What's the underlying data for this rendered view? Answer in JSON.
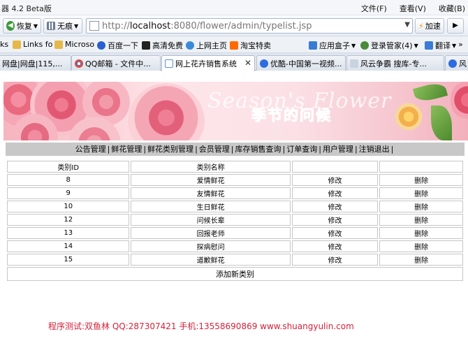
{
  "browser": {
    "app_title": "器 4.2 Beta版",
    "menus": [
      "文件(F)",
      "查看(V)",
      "收藏(B)"
    ],
    "toolbar": {
      "back_label": "恢复",
      "trace_label": "无痕",
      "url_scheme": "http://",
      "url_host": "localhost",
      "url_rest": ":8080/flower/admin/typelist.jsp",
      "speed_label": "加速"
    },
    "bookmarks": [
      {
        "label": "ks",
        "icon": "bookmark-icon",
        "color": "#5b7db8"
      },
      {
        "label": "Links fo",
        "icon": "folder-icon",
        "color": "#e6b84a"
      },
      {
        "label": "Microso",
        "icon": "folder-icon",
        "color": "#e6b84a"
      },
      {
        "label": "百度一下",
        "icon": "baidu-paw-icon",
        "color": "#2b5fcf"
      },
      {
        "label": "高清免费",
        "icon": "movie-icon",
        "color": "#222222"
      },
      {
        "label": "上网主页",
        "icon": "home-page-icon",
        "color": "#3b8ad8"
      },
      {
        "label": "淘宝特卖",
        "icon": "taobao-icon",
        "color": "#ff6a00"
      },
      {
        "label": "应用盒子",
        "icon": "app-box-icon",
        "color": "#3a7bd5"
      },
      {
        "label": "登录管家(4)",
        "icon": "login-manager-icon",
        "color": "#4a8a3a"
      },
      {
        "label": "翻译",
        "icon": "translate-icon",
        "color": "#3a7bd5"
      }
    ],
    "tabs": [
      {
        "label": "网盘|网盘|115,...",
        "icon": "tab-page-icon",
        "color": "#7a9fd1",
        "active": false
      },
      {
        "label": "QQ邮箱 - 文件中...",
        "icon": "chrome-tab-icon",
        "color": "#e0493a",
        "active": false
      },
      {
        "label": "网上花卉销售系统",
        "icon": "tab-page-icon",
        "color": "#5b8fd6",
        "active": true
      },
      {
        "label": "优酷-中国第一视频...",
        "icon": "youku-icon",
        "color": "#2d6cdf",
        "active": false
      },
      {
        "label": "风云争霸 搜库-专...",
        "icon": "tab-page-icon",
        "color": "#9aa9bd",
        "active": false
      },
      {
        "label": "风",
        "icon": "youku-icon",
        "color": "#2d6cdf",
        "active": false
      }
    ]
  },
  "page": {
    "banner": {
      "title": "季节的问候",
      "watermark": "Season's Flower"
    },
    "nav_items": [
      "公告管理",
      "鲜花管理",
      "鲜花类别管理",
      "会员管理",
      "库存销售查询",
      "订单查询",
      "用户管理",
      "注销退出"
    ],
    "table": {
      "headers": [
        "类别ID",
        "类别名称",
        "",
        ""
      ],
      "rows": [
        {
          "id": "8",
          "name": "爱情鲜花",
          "edit": "修改",
          "delete": "删除"
        },
        {
          "id": "9",
          "name": "友情鲜花",
          "edit": "修改",
          "delete": "删除"
        },
        {
          "id": "10",
          "name": "生日鲜花",
          "edit": "修改",
          "delete": "删除"
        },
        {
          "id": "12",
          "name": "问候长辈",
          "edit": "修改",
          "delete": "删除"
        },
        {
          "id": "13",
          "name": "回报老师",
          "edit": "修改",
          "delete": "删除"
        },
        {
          "id": "14",
          "name": "探病慰问",
          "edit": "修改",
          "delete": "删除"
        },
        {
          "id": "15",
          "name": "道歉鲜花",
          "edit": "修改",
          "delete": "删除"
        }
      ],
      "add_label": "添加新类别"
    },
    "footer": "程序测试:双鱼林 QQ:287307421 手机:13558690869 www.shuangyulin.com"
  }
}
